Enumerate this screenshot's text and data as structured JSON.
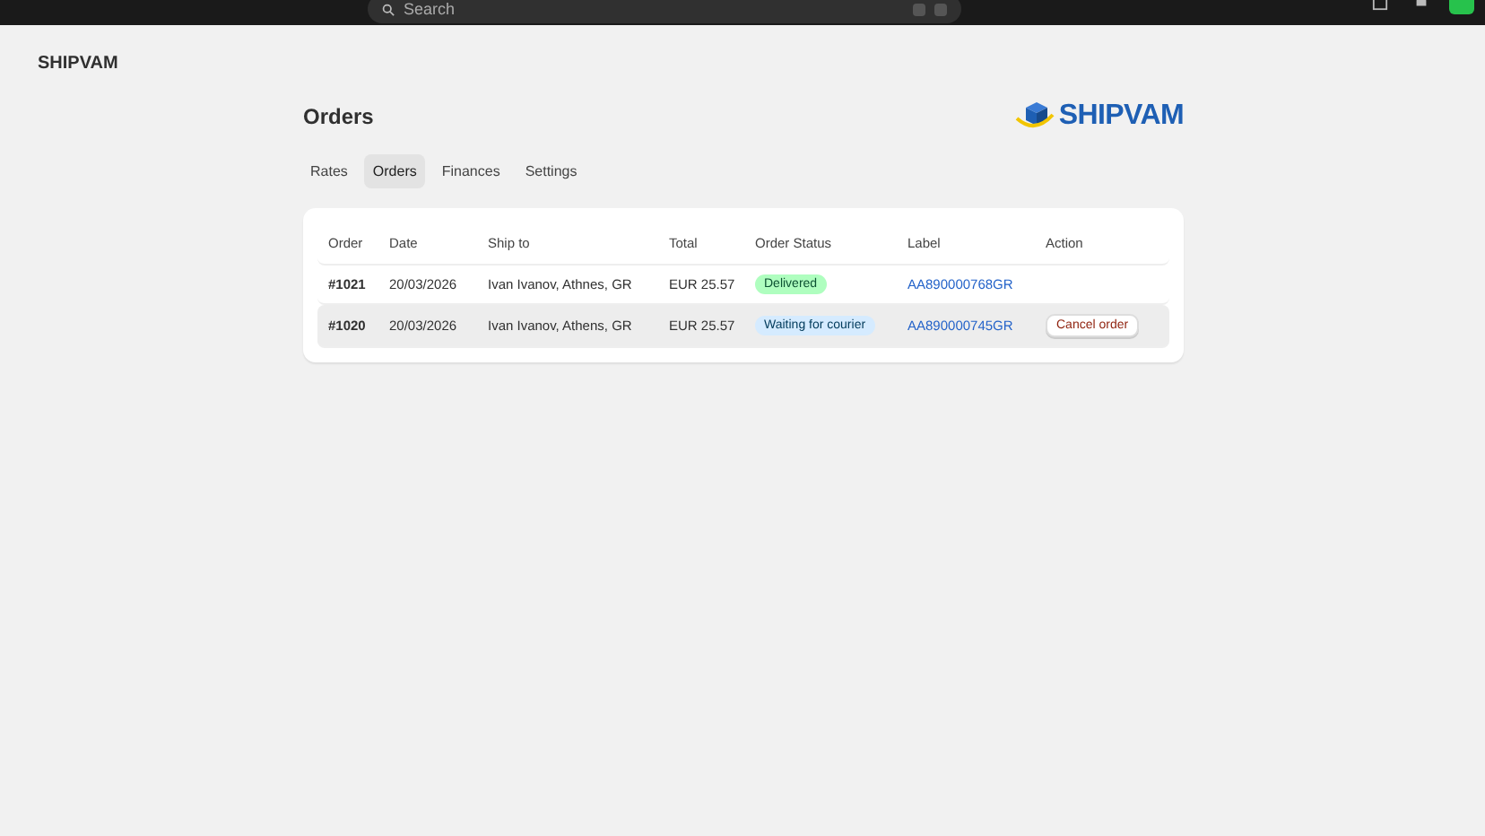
{
  "topbar": {
    "search": {
      "placeholder": "Search"
    }
  },
  "store": {
    "name": "SHIPVAM"
  },
  "page": {
    "title": "Orders",
    "logo_text": "SHIPVAM"
  },
  "tabs": [
    {
      "label": "Rates",
      "selected": false
    },
    {
      "label": "Orders",
      "selected": true
    },
    {
      "label": "Finances",
      "selected": false
    },
    {
      "label": "Settings",
      "selected": false
    }
  ],
  "table": {
    "columns": [
      "Order",
      "Date",
      "Ship to",
      "Total",
      "Order Status",
      "Label",
      "Action"
    ],
    "rows": [
      {
        "order": "#1021",
        "date": "20/03/2026",
        "ship_to": "Ivan Ivanov, Athnes, GR",
        "total": "EUR 25.57",
        "status": {
          "text": "Delivered",
          "kind": "success"
        },
        "label": "AA890000768GR",
        "highlighted": false
      },
      {
        "order": "#1020",
        "date": "20/03/2026",
        "ship_to": "Ivan Ivanov, Athens, GR",
        "total": "EUR 25.57",
        "status": {
          "text": "Waiting for courier",
          "kind": "info"
        },
        "label": "AA890000745GR",
        "action": "Cancel order",
        "highlighted": true
      }
    ]
  }
}
